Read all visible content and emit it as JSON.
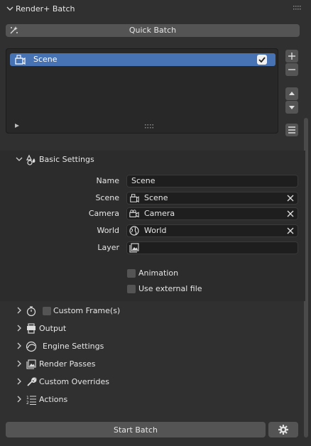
{
  "panel": {
    "title": "Render+ Batch"
  },
  "quick_batch": {
    "label": "Quick Batch"
  },
  "list": {
    "items": [
      {
        "label": "Scene",
        "enabled": true
      }
    ]
  },
  "basic_settings": {
    "title": "Basic Settings",
    "name": {
      "label": "Name",
      "value": "Scene"
    },
    "scene": {
      "label": "Scene",
      "value": "Scene"
    },
    "camera": {
      "label": "Camera",
      "value": "Camera"
    },
    "world": {
      "label": "World",
      "value": "World"
    },
    "layer": {
      "label": "Layer",
      "value": ""
    },
    "animation": {
      "label": "Animation",
      "checked": false
    },
    "use_external_file": {
      "label": "Use external file",
      "checked": false
    }
  },
  "sections": {
    "custom_frames": "Custom Frame(s)",
    "output": "Output",
    "engine_settings": "Engine Settings",
    "render_passes": "Render Passes",
    "custom_overrides": "Custom Overrides",
    "actions": "Actions"
  },
  "footer": {
    "start_batch": "Start Batch"
  },
  "icons": [
    "chevron-down-icon",
    "grip-icon",
    "sparkle-icon",
    "scene-icon",
    "checkbox-checked-icon",
    "plus-icon",
    "minus-icon",
    "arrow-up-icon",
    "arrow-down-icon",
    "menu-icon",
    "play-icon",
    "shapes-icon",
    "camera-icon",
    "globe-icon",
    "image-icon",
    "x-icon",
    "stopwatch-icon",
    "printer-icon",
    "engine-icon",
    "render-passes-icon",
    "wrench-icon",
    "ordered-list-icon",
    "gear-icon"
  ],
  "colors": {
    "accent": "#4772b3",
    "panel": "#303030",
    "field": "#1e1e1e",
    "button": "#545454"
  }
}
